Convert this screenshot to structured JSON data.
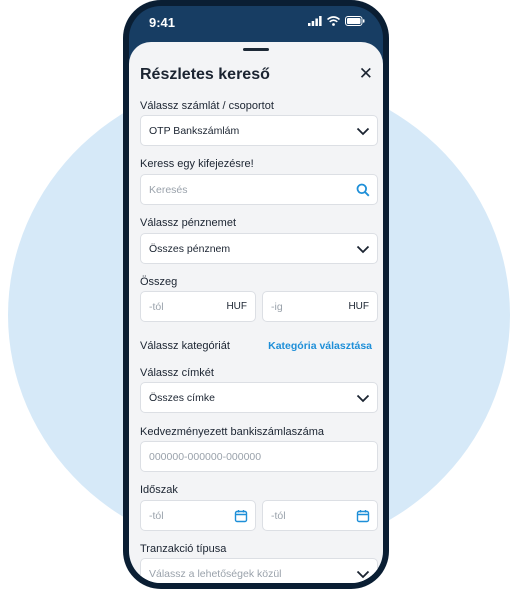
{
  "status_bar": {
    "time": "9:41"
  },
  "sheet": {
    "title": "Részletes kereső",
    "close_symbol": "✕",
    "account": {
      "label": "Válassz számlát / csoportot",
      "value": "OTP Bankszámlám"
    },
    "search": {
      "label": "Keress egy kifejezésre!",
      "placeholder": "Keresés"
    },
    "currency": {
      "label": "Válassz pénznemet",
      "value": "Összes pénznem"
    },
    "amount": {
      "label": "Összeg",
      "from_placeholder": "-tól",
      "to_placeholder": "-ig",
      "unit": "HUF"
    },
    "category": {
      "label": "Válassz kategóriát",
      "link": "Kategória választása"
    },
    "tag": {
      "label": "Válassz címkét",
      "value": "Összes címke"
    },
    "beneficiary": {
      "label": "Kedvezményezett bankiszámlaszáma",
      "placeholder": "000000-000000-000000"
    },
    "period": {
      "label": "Időszak",
      "from_placeholder": "-tól",
      "to_placeholder": "-tól"
    },
    "transaction_type": {
      "label": "Tranzakció típusa",
      "placeholder": "Válassz a lehetőségek közül"
    }
  },
  "colors": {
    "accent": "#1e8fd8",
    "header": "#173d63",
    "background_circle": "#d6e9f8"
  }
}
